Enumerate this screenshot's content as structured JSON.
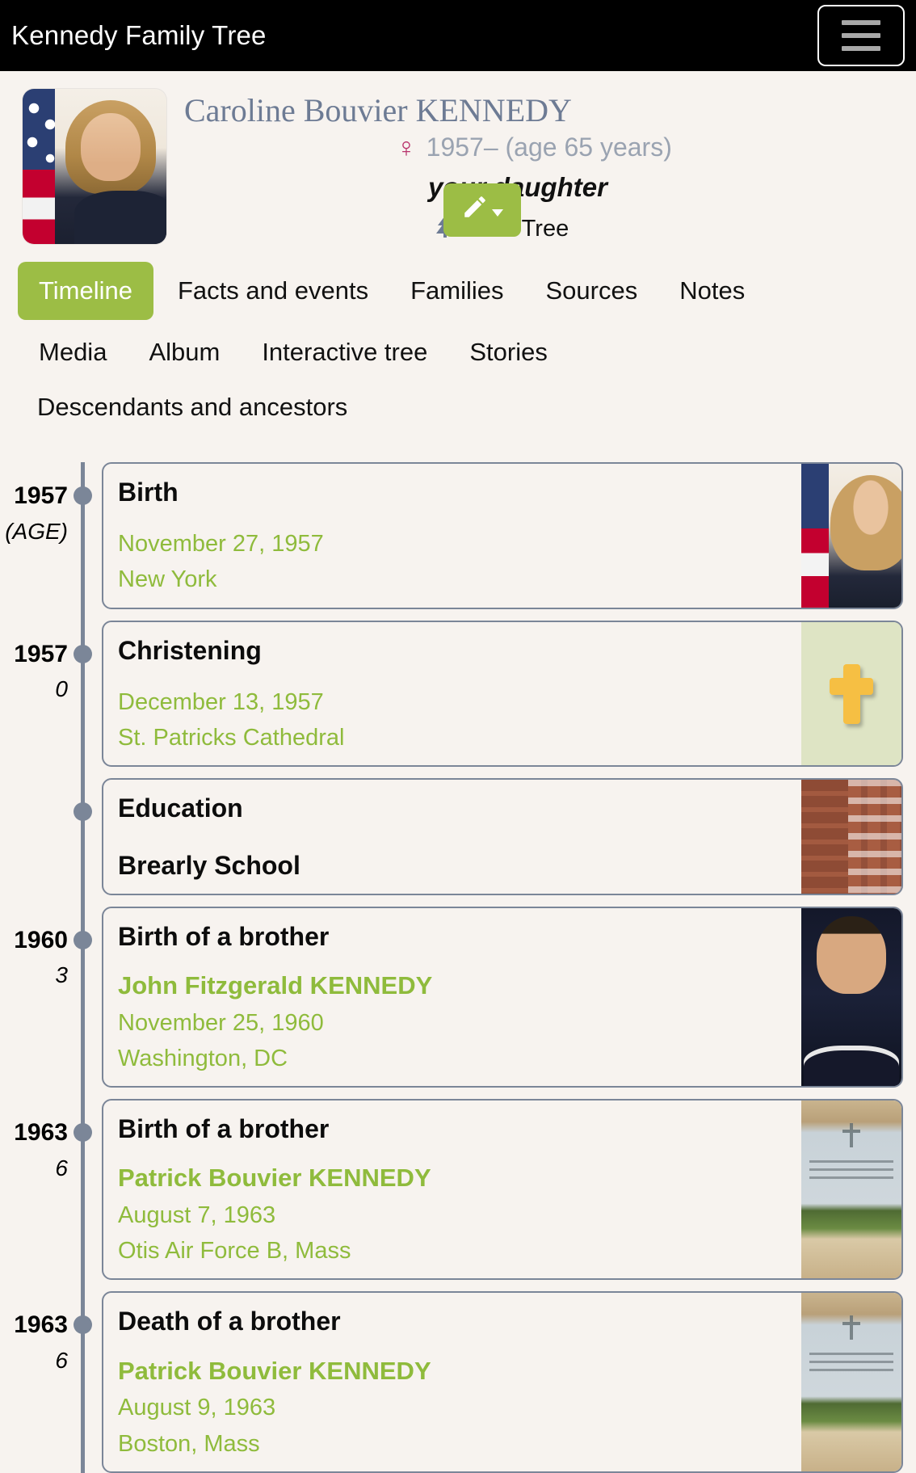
{
  "header": {
    "title": "Kennedy Family Tree",
    "menu_icon": "hamburger-menu-icon"
  },
  "profile": {
    "name": "Caroline Bouvier KENNEDY",
    "sex_icon": "female-symbol",
    "sex_glyph": "♀",
    "life_dates": "1957– (age 65 years)",
    "relation": "your daughter",
    "tree_icon": "tree-icon",
    "tree_glyph": "ἳ2",
    "view_tree_label": "View Tree",
    "edit_icon": "pencil-icon",
    "edit_glyph": "✎",
    "avatar_alt": "Caroline Bouvier Kennedy portrait"
  },
  "tabs": {
    "row1": [
      {
        "label": "Timeline",
        "active": true
      },
      {
        "label": "Facts and events",
        "active": false
      },
      {
        "label": "Families",
        "active": false
      },
      {
        "label": "Sources",
        "active": false
      },
      {
        "label": "Notes",
        "active": false
      }
    ],
    "row2": [
      {
        "label": "Media"
      },
      {
        "label": "Album"
      },
      {
        "label": "Interactive tree"
      },
      {
        "label": "Stories"
      }
    ],
    "row3": [
      {
        "label": "Descendants and ancestors"
      }
    ]
  },
  "timeline": {
    "events": [
      {
        "year": "1957",
        "age": "(AGE)",
        "title": "Birth",
        "person": "",
        "date": "November 27, 1957",
        "place": "New York",
        "thumb": "portrait-caroline"
      },
      {
        "year": "1957",
        "age": "0",
        "title": "Christening",
        "person": "",
        "date": "December 13, 1957",
        "place": "St. Patricks Cathedral",
        "thumb": "cross"
      },
      {
        "year": "",
        "age": "",
        "title": "Education",
        "subtitle": "Brearly School",
        "person": "",
        "date": "",
        "place": "",
        "thumb": "building"
      },
      {
        "year": "1960",
        "age": "3",
        "title": "Birth of a brother",
        "person": "John Fitzgerald KENNEDY",
        "date": "November 25, 1960",
        "place": "Washington, DC",
        "thumb": "portrait-jfk"
      },
      {
        "year": "1963",
        "age": "6",
        "title": "Birth of a brother",
        "person": "Patrick Bouvier KENNEDY",
        "date": "August 7, 1963",
        "place": "Otis Air Force B, Mass",
        "thumb": "grave"
      },
      {
        "year": "1963",
        "age": "6",
        "title": "Death of a brother",
        "person": "Patrick Bouvier KENNEDY",
        "date": "August 9, 1963",
        "place": "Boston, Mass",
        "thumb": "grave"
      }
    ]
  },
  "colors": {
    "accent_green": "#9cbd45",
    "link_green": "#8fbb3c",
    "header_black": "#000000",
    "page_bg": "#f7f3ef",
    "slate": "#7b8698",
    "name_slate": "#6d7b94",
    "muted_gray": "#9aa3b1",
    "female_pink": "#b8326b",
    "cross_gold": "#f6bf43",
    "cross_bg": "#dee4c4"
  }
}
